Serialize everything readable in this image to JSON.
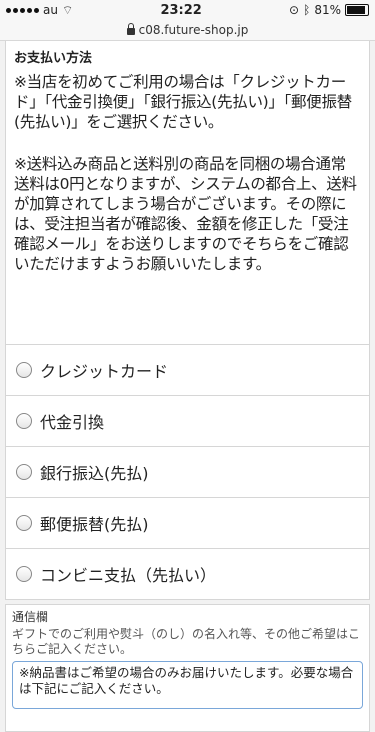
{
  "status_bar": {
    "carrier": "au",
    "time": "23:22",
    "battery": "81%",
    "battery_level": 0.81
  },
  "browser": {
    "url": "c08.future-shop.jp"
  },
  "payment": {
    "title": "お支払い方法",
    "para1": "※当店を初めてご利用の場合は「クレジットカード」「代金引換便」「銀行振込(先払い)」「郵便振替(先払い)」をご選択ください。",
    "para2": "※送料込み商品と送料別の商品を同梱の場合通常送料は0円となりますが、システムの都合上、送料が加算されてしまう場合がございます。その際には、受注担当者が確認後、金額を修正した「受注確認メール」をお送りしますのでそちらをご確認いただけますようお願いいたします。",
    "options": [
      "クレジットカード",
      "代金引換",
      "銀行振込(先払)",
      "郵便振替(先払)",
      "コンビニ支払（先払い）"
    ]
  },
  "notes": {
    "title": "通信欄",
    "description": "ギフトでのご利用や熨斗（のし）の名入れ等、その他ご希望はこちらご記入ください。",
    "textarea_value": "※納品書はご希望の場合のみお届けいたします。必要な場合は下記にご記入ください。"
  }
}
